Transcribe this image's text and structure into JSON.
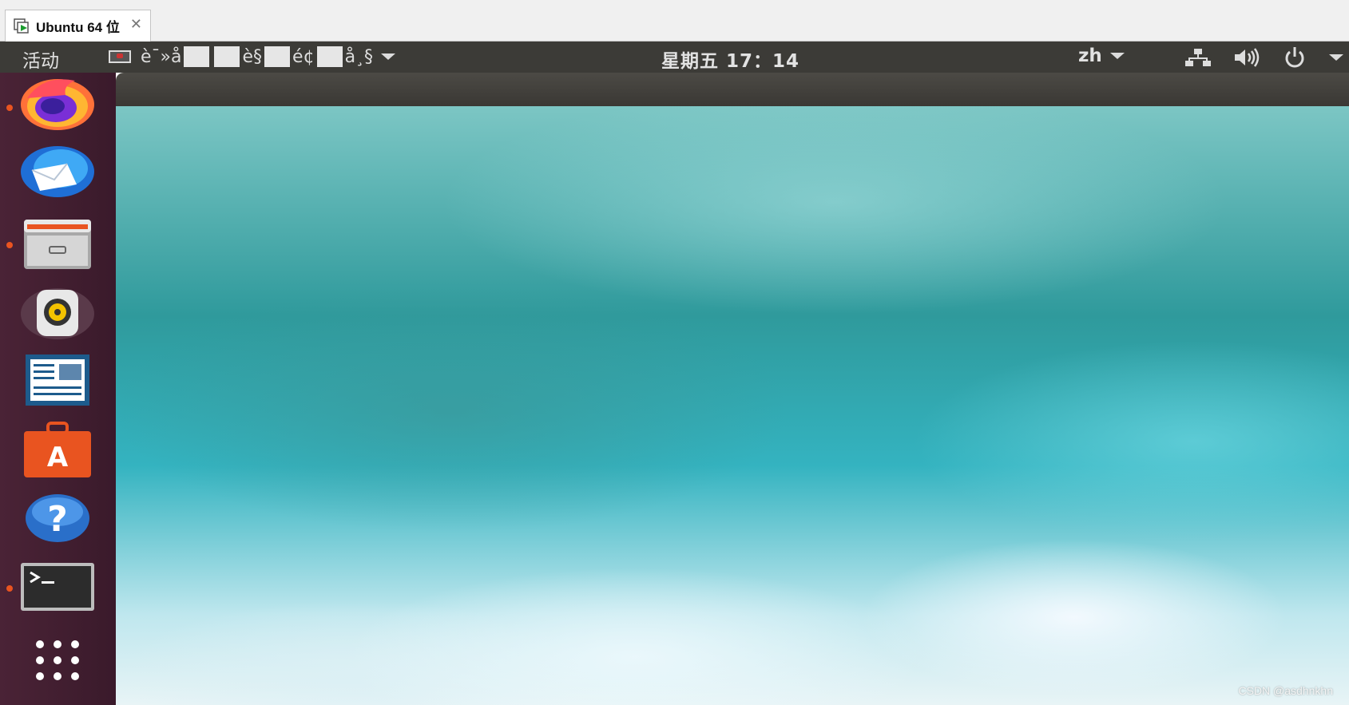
{
  "host": {
    "tab_title": "Ubuntu 64 位",
    "close_glyph": "✕",
    "tab_icon": "vm-play-icon"
  },
  "topbar": {
    "activities": "活动",
    "app_menu_parts": [
      "è¯»å",
      "è§",
      "é¢",
      "å¸§"
    ],
    "clock": "星期五 17：14",
    "lang": "zh",
    "icons": [
      "network-icon",
      "volume-icon",
      "power-icon",
      "system-menu-caret-icon"
    ]
  },
  "dock": {
    "items": [
      {
        "name": "firefox",
        "running": true
      },
      {
        "name": "thunderbird",
        "running": false
      },
      {
        "name": "files",
        "running": true
      },
      {
        "name": "rhythmbox",
        "running": false
      },
      {
        "name": "libreoffice-writer",
        "running": false
      },
      {
        "name": "ubuntu-software",
        "running": false
      },
      {
        "name": "help",
        "running": false
      },
      {
        "name": "terminal",
        "running": true
      },
      {
        "name": "show-applications",
        "running": false
      }
    ]
  },
  "watermark": "CSDN @asdhnkhn",
  "colors": {
    "topbar": "#3c3b37",
    "dock": "#3f1a2e",
    "running_dot": "#e95420",
    "wallpaper": "#34b3c0"
  }
}
